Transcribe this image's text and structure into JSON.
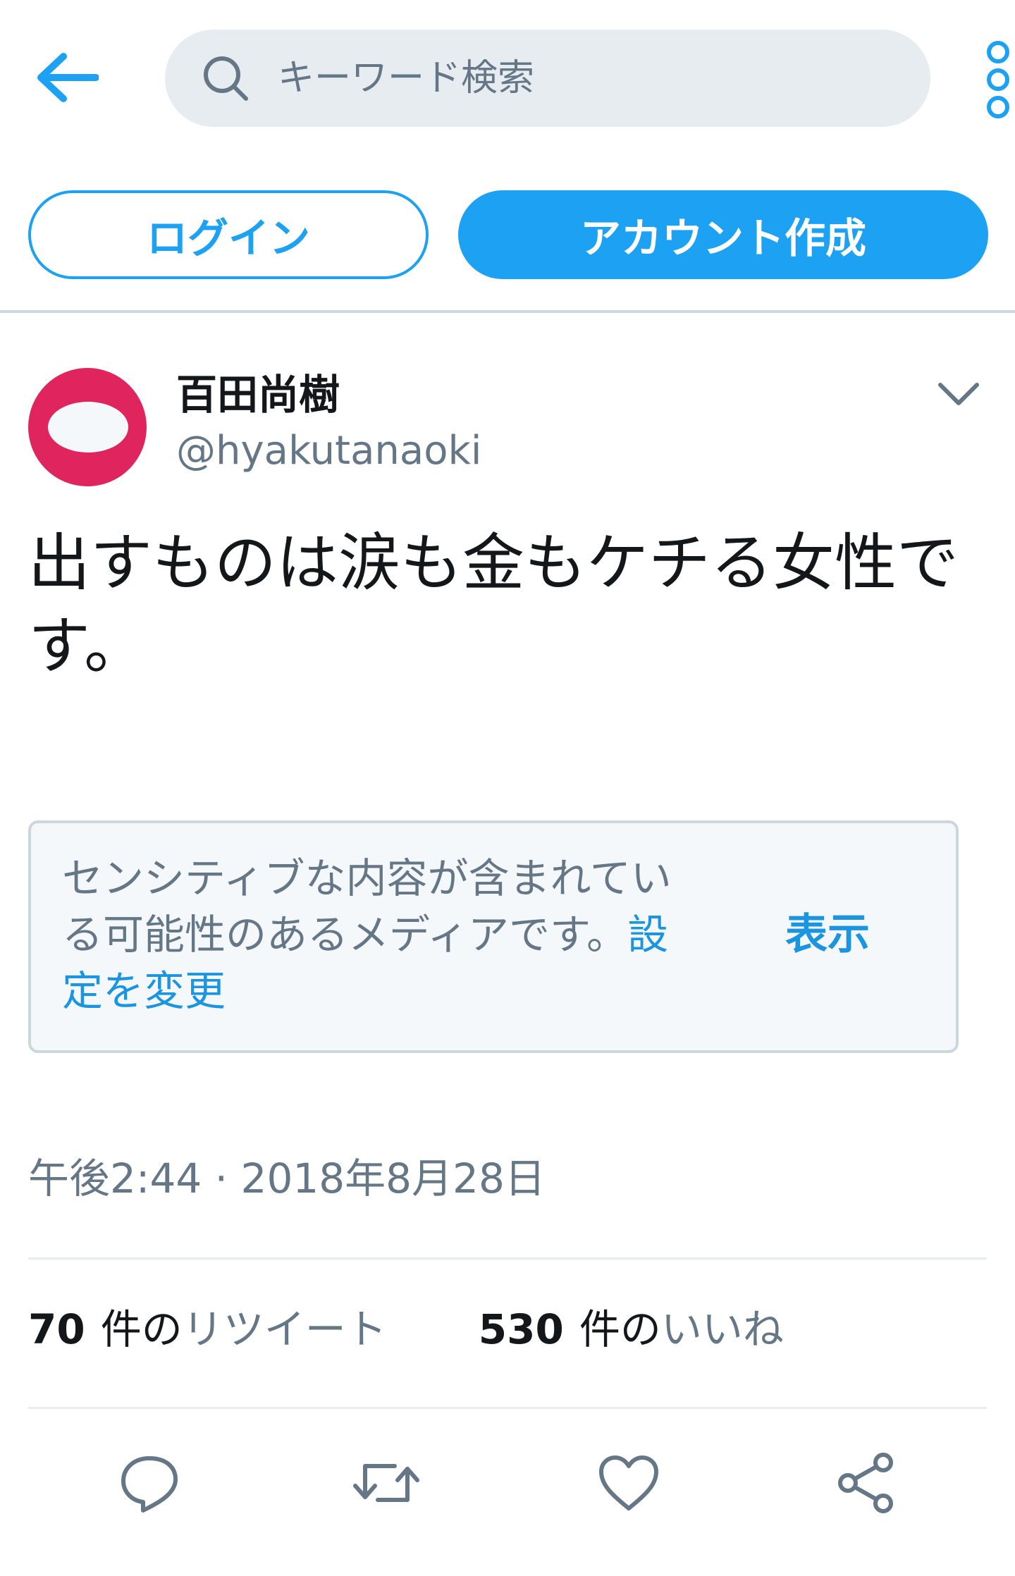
{
  "search": {
    "placeholder": "キーワード検索"
  },
  "icons": {
    "back": "arrow-left-icon",
    "search": "search-icon",
    "more": "more-vertical-icon",
    "caret": "chevron-down-icon",
    "reply": "reply-icon",
    "retweet": "retweet-icon",
    "like": "heart-icon",
    "share": "share-icon"
  },
  "colors": {
    "accent": "#1da1f2",
    "link": "#1b95e0",
    "muted": "#657786",
    "avatar_bg": "#e0245e"
  },
  "auth": {
    "login_label": "ログイン",
    "signup_label": "アカウント作成"
  },
  "tweet": {
    "display_name": "百田尚樹",
    "handle": "@hyakutanaoki",
    "text": "出すものは涙も金もケチる女性です。",
    "timestamp": "午後2:44 · 2018年8月28日"
  },
  "sensitive_media": {
    "message": "センシティブな内容が含まれている可能性のあるメディアです。",
    "settings_link": "設定を変更",
    "show_label": "表示"
  },
  "stats": {
    "retweets": {
      "count": "70",
      "label_prefix": "件の",
      "label": "リツイート"
    },
    "likes": {
      "count": "530",
      "label_prefix": "件の",
      "label": "いいね"
    }
  }
}
